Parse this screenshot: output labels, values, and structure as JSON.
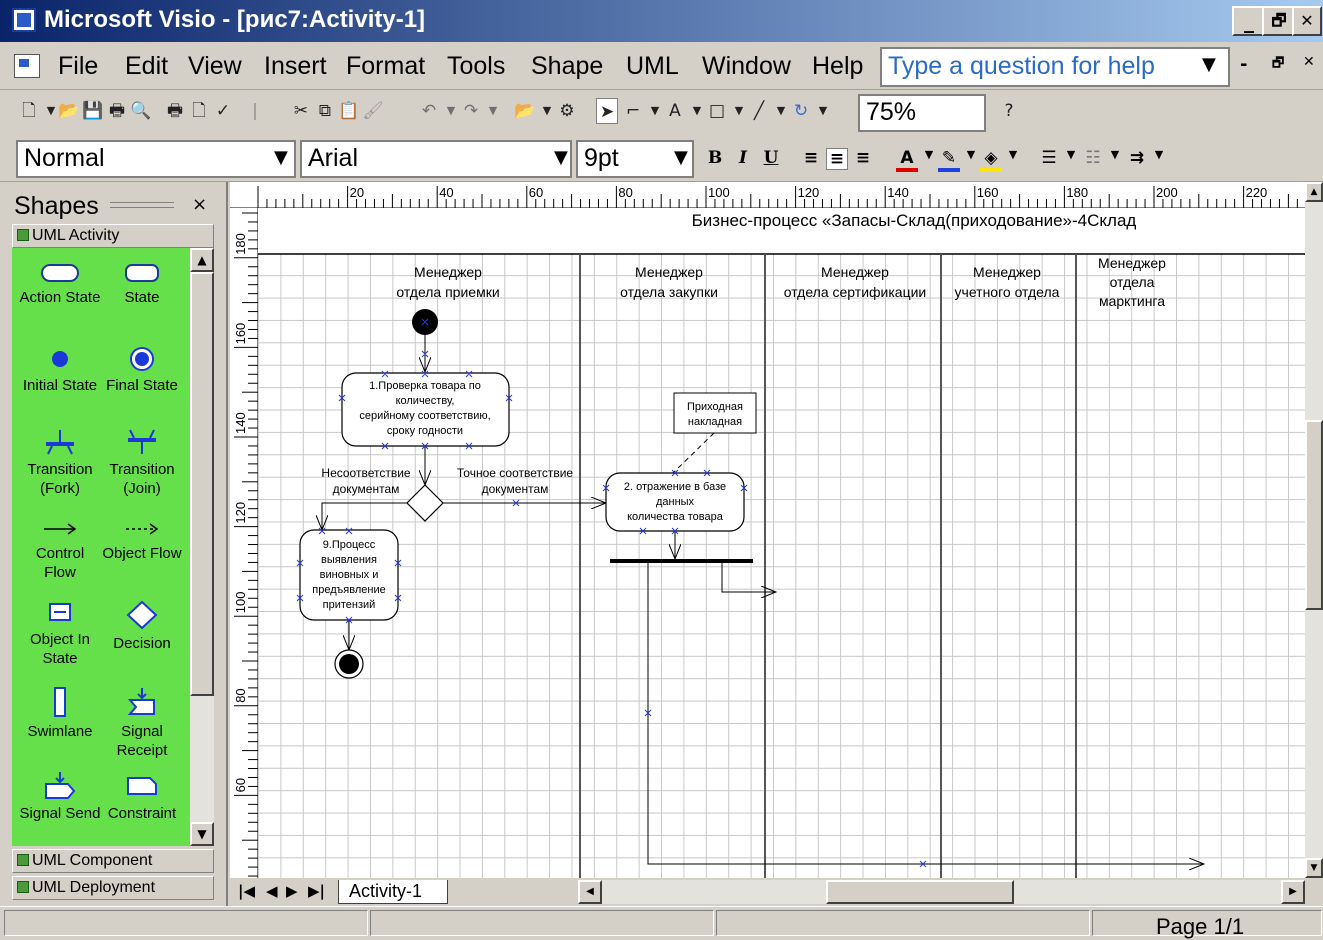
{
  "window": {
    "title": "Microsoft Visio - [рис7:Activity-1]",
    "minimize": "_",
    "restore": "🗗",
    "close": "✕"
  },
  "menu": {
    "items": [
      "File",
      "Edit",
      "View",
      "Insert",
      "Format",
      "Tools",
      "Shape",
      "UML",
      "Window",
      "Help"
    ],
    "help_placeholder": "Type a question for help"
  },
  "toolbar": {
    "zoom": "75%"
  },
  "format_toolbar": {
    "style": "Normal",
    "font": "Arial",
    "size": "9pt",
    "bold": "B",
    "italic": "I",
    "underline": "U"
  },
  "shapes_pane": {
    "title": "Shapes",
    "close": "×",
    "stencils": [
      "UML Activity",
      "UML Component",
      "UML Deployment"
    ],
    "shapes": [
      {
        "label": "Action State",
        "icon": "action-state-icon"
      },
      {
        "label": "State",
        "icon": "state-icon"
      },
      {
        "label": "Initial State",
        "icon": "initial-state-icon"
      },
      {
        "label": "Final State",
        "icon": "final-state-icon"
      },
      {
        "label": "Transition (Fork)",
        "icon": "fork-icon"
      },
      {
        "label": "Transition (Join)",
        "icon": "join-icon"
      },
      {
        "label": "Control Flow",
        "icon": "control-flow-icon"
      },
      {
        "label": "Object Flow",
        "icon": "object-flow-icon"
      },
      {
        "label": "Object In State",
        "icon": "object-in-state-icon"
      },
      {
        "label": "Decision",
        "icon": "decision-icon"
      },
      {
        "label": "Swimlane",
        "icon": "swimlane-icon"
      },
      {
        "label": "Signal Receipt",
        "icon": "signal-receipt-icon"
      },
      {
        "label": "Signal Send",
        "icon": "signal-send-icon"
      },
      {
        "label": "Constraint",
        "icon": "constraint-icon"
      }
    ]
  },
  "ruler": {
    "h_ticks": [
      "20",
      "40",
      "60",
      "80",
      "100",
      "120",
      "140",
      "160",
      "180",
      "200",
      "220"
    ],
    "v_ticks": [
      "180",
      "160",
      "140",
      "120",
      "100",
      "80",
      "60"
    ]
  },
  "diagram": {
    "title": "Бизнес-процесс «Запасы-Склад(приходование»-4Склад",
    "lanes": [
      {
        "line1": "Менеджер",
        "line2": "отдела приемки",
        "line3": ""
      },
      {
        "line1": "Менеджер",
        "line2": "отдела закупки",
        "line3": ""
      },
      {
        "line1": "Менеджер",
        "line2": "отдела сертификации",
        "line3": ""
      },
      {
        "line1": "Менеджер",
        "line2": "учетного отдела",
        "line3": ""
      },
      {
        "line1": "Менеджер",
        "line2": "отдела",
        "line3": "марктинга"
      }
    ],
    "activities": [
      {
        "lines": [
          "1.Проверка товара по",
          "количеству,",
          "серийному соответствию,",
          "сроку годности"
        ]
      },
      {
        "lines": [
          "2. отражение  в базе",
          "данных",
          "количества товара"
        ]
      },
      {
        "lines": [
          "9.Процесс",
          "выявления",
          "виновных и",
          "предъявление",
          "притензий"
        ]
      }
    ],
    "object_node": {
      "lines": [
        "Приходная",
        "накладная"
      ]
    },
    "guards": {
      "mismatch": [
        "Несоответствие",
        "документам"
      ],
      "match": [
        "Точное соответствие",
        "документам"
      ]
    }
  },
  "tabs": {
    "active": "Activity-1",
    "nav": [
      "|◀",
      "◀",
      "▶",
      "▶|"
    ]
  },
  "status": {
    "page": "Page 1/1"
  },
  "colors": {
    "stencil_bg": "#66e04a",
    "title_bar": "#0a246a",
    "help_text": "#2a6ac8"
  }
}
